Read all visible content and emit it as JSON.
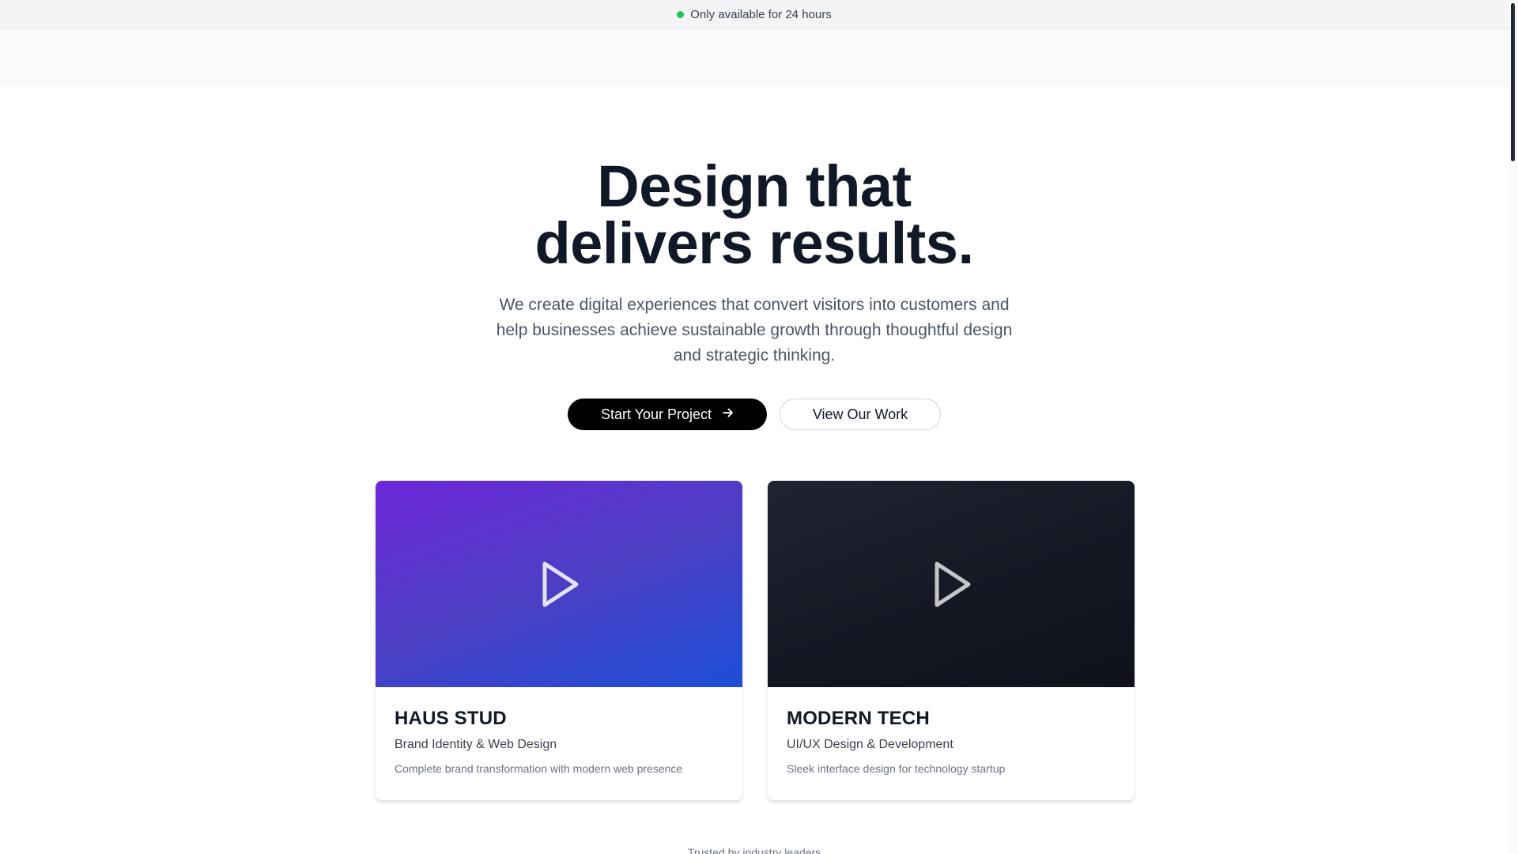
{
  "announcement": {
    "text": "Only available for 24 hours",
    "dot_color": "#22c55e"
  },
  "hero": {
    "title_line1": "Design that",
    "title_line2": "delivers results.",
    "subtitle": "We create digital experiences that convert visitors into customers and help businesses achieve sustainable growth through thoughtful design and strategic thinking."
  },
  "cta": {
    "primary_label": "Start Your Project",
    "primary_icon": "arrow-right-icon",
    "secondary_label": "View Our Work"
  },
  "cards": [
    {
      "title": "HAUS STUD",
      "category": "Brand Identity & Web Design",
      "description": "Complete brand transformation with modern web presence",
      "icon": "play-icon",
      "gradient_from": "#6d28d9",
      "gradient_to": "#1d4ed8"
    },
    {
      "title": "MODERN TECH",
      "category": "UI/UX Design & Development",
      "description": "Sleek interface design for technology startup",
      "icon": "play-icon",
      "gradient_from": "#1f2430",
      "gradient_to": "#0f121b"
    }
  ],
  "trusted": {
    "text": "Trusted by industry leaders"
  }
}
